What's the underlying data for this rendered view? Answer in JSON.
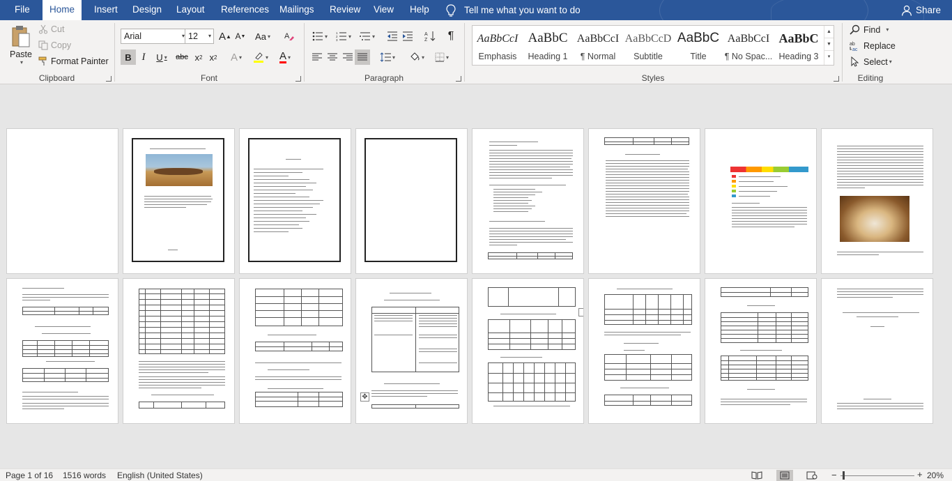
{
  "tabs": {
    "file": "File",
    "home": "Home",
    "insert": "Insert",
    "design": "Design",
    "layout": "Layout",
    "references": "References",
    "mailings": "Mailings",
    "review": "Review",
    "view": "View",
    "help": "Help"
  },
  "tell_me": "Tell me what you want to do",
  "share": "Share",
  "clipboard": {
    "paste": "Paste",
    "cut": "Cut",
    "copy": "Copy",
    "format_painter": "Format Painter",
    "label": "Clipboard"
  },
  "font": {
    "name": "Arial",
    "size": "12",
    "label": "Font",
    "grow": "A",
    "shrink": "A",
    "case": "Aa",
    "bold": "B",
    "italic": "I",
    "underline": "U",
    "strike": "abc",
    "sub": "x",
    "sup": "x",
    "sub_mark": "2",
    "sup_mark": "2",
    "effects": "A",
    "color": "A"
  },
  "paragraph": {
    "label": "Paragraph"
  },
  "styles": {
    "label": "Styles",
    "items": [
      {
        "preview": "AaBbCcI",
        "name": "Emphasis"
      },
      {
        "preview": "AaBbC",
        "name": "Heading 1"
      },
      {
        "preview": "AaBbCcI",
        "name": "¶ Normal"
      },
      {
        "preview": "AaBbCcD",
        "name": "Subtitle"
      },
      {
        "preview": "AaBbC",
        "name": "Title"
      },
      {
        "preview": "AaBbCcI",
        "name": "¶ No Spac..."
      },
      {
        "preview": "AaBbC",
        "name": "Heading 3"
      }
    ]
  },
  "editing": {
    "find": "Find",
    "replace": "Replace",
    "select": "Select",
    "label": "Editing"
  },
  "status": {
    "page": "Page 1 of 16",
    "words": "1516 words",
    "language": "English (United States)",
    "zoom": "20%"
  },
  "colors": {
    "accent": "#2b579a",
    "highlight": "#ffff00",
    "font_color": "#ff0000"
  },
  "icons": [
    "lightbulb-icon",
    "person-icon",
    "clipboard-icon",
    "scissors-icon",
    "copy-icon",
    "brush-icon",
    "search-icon",
    "replace-icon",
    "cursor-icon",
    "read-mode-icon",
    "print-layout-icon",
    "web-layout-icon"
  ]
}
